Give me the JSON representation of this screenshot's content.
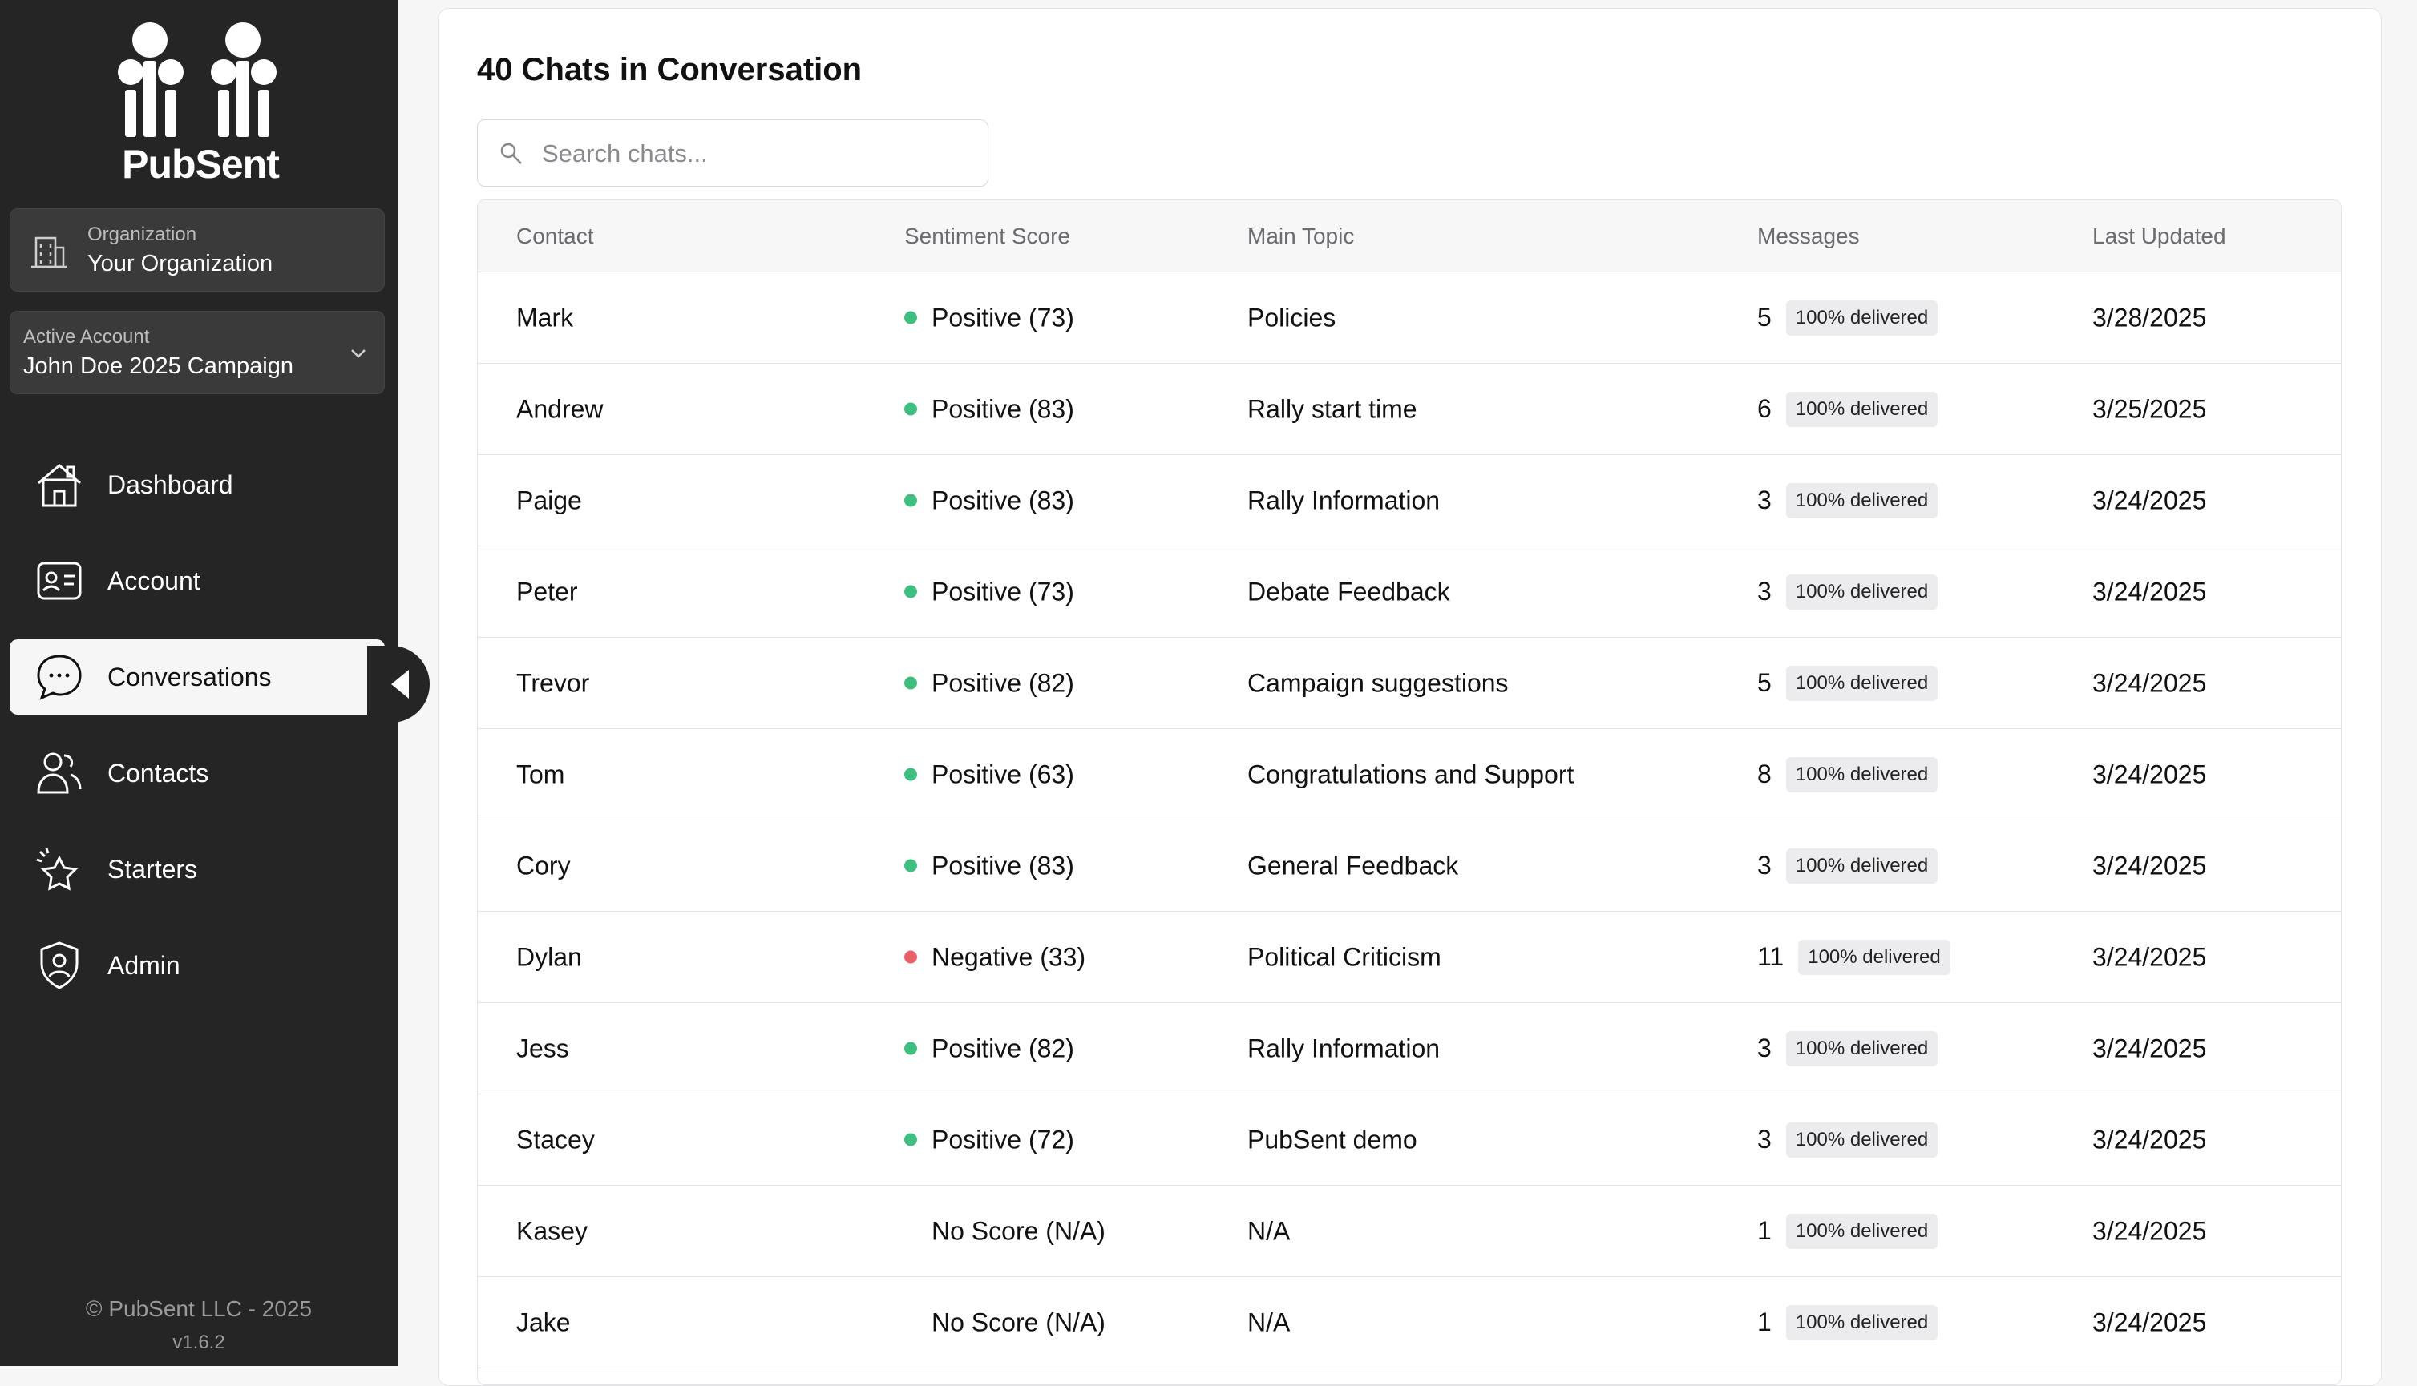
{
  "sidebar": {
    "brand": "PubSent",
    "organization": {
      "label": "Organization",
      "value": "Your Organization"
    },
    "active_account": {
      "label": "Active Account",
      "value": "John Doe 2025 Campaign"
    },
    "nav": [
      {
        "label": "Dashboard",
        "icon": "house-icon",
        "active": false
      },
      {
        "label": "Account",
        "icon": "id-card-icon",
        "active": false
      },
      {
        "label": "Conversations",
        "icon": "chat-bubble-icon",
        "active": true
      },
      {
        "label": "Contacts",
        "icon": "users-icon",
        "active": false
      },
      {
        "label": "Starters",
        "icon": "sparkle-icon",
        "active": false
      },
      {
        "label": "Admin",
        "icon": "shield-user-icon",
        "active": false
      }
    ],
    "copyright": "© PubSent LLC - 2025",
    "version": "v1.6.2"
  },
  "main": {
    "title": "40 Chats in Conversation",
    "search": {
      "placeholder": "Search chats..."
    },
    "columns": [
      "Contact",
      "Sentiment Score",
      "Main Topic",
      "Messages",
      "Last Updated"
    ],
    "rows": [
      {
        "contact": "Mark",
        "sentiment": "Positive (73)",
        "tone": "positive",
        "topic": "Policies",
        "messages": "5",
        "status": "100% delivered",
        "updated": "3/28/2025"
      },
      {
        "contact": "Andrew",
        "sentiment": "Positive (83)",
        "tone": "positive",
        "topic": "Rally start time",
        "messages": "6",
        "status": "100% delivered",
        "updated": "3/25/2025"
      },
      {
        "contact": "Paige",
        "sentiment": "Positive (83)",
        "tone": "positive",
        "topic": "Rally Information",
        "messages": "3",
        "status": "100% delivered",
        "updated": "3/24/2025"
      },
      {
        "contact": "Peter",
        "sentiment": "Positive (73)",
        "tone": "positive",
        "topic": "Debate Feedback",
        "messages": "3",
        "status": "100% delivered",
        "updated": "3/24/2025"
      },
      {
        "contact": "Trevor",
        "sentiment": "Positive (82)",
        "tone": "positive",
        "topic": "Campaign suggestions",
        "messages": "5",
        "status": "100% delivered",
        "updated": "3/24/2025"
      },
      {
        "contact": "Tom",
        "sentiment": "Positive (63)",
        "tone": "positive",
        "topic": "Congratulations and Support",
        "messages": "8",
        "status": "100% delivered",
        "updated": "3/24/2025"
      },
      {
        "contact": "Cory",
        "sentiment": "Positive (83)",
        "tone": "positive",
        "topic": "General Feedback",
        "messages": "3",
        "status": "100% delivered",
        "updated": "3/24/2025"
      },
      {
        "contact": "Dylan",
        "sentiment": "Negative (33)",
        "tone": "negative",
        "topic": "Political Criticism",
        "messages": "11",
        "status": "100% delivered",
        "updated": "3/24/2025"
      },
      {
        "contact": "Jess",
        "sentiment": "Positive (82)",
        "tone": "positive",
        "topic": "Rally Information",
        "messages": "3",
        "status": "100% delivered",
        "updated": "3/24/2025"
      },
      {
        "contact": "Stacey",
        "sentiment": "Positive (72)",
        "tone": "positive",
        "topic": "PubSent demo",
        "messages": "3",
        "status": "100% delivered",
        "updated": "3/24/2025"
      },
      {
        "contact": "Kasey",
        "sentiment": "No Score (N/A)",
        "tone": "none",
        "topic": "N/A",
        "messages": "1",
        "status": "100% delivered",
        "updated": "3/24/2025"
      },
      {
        "contact": "Jake",
        "sentiment": "No Score (N/A)",
        "tone": "none",
        "topic": "N/A",
        "messages": "1",
        "status": "100% delivered",
        "updated": "3/24/2025"
      }
    ]
  },
  "colors": {
    "sidebar_bg": "#252525",
    "positive": "#3fbf7f",
    "negative": "#e8606a"
  }
}
